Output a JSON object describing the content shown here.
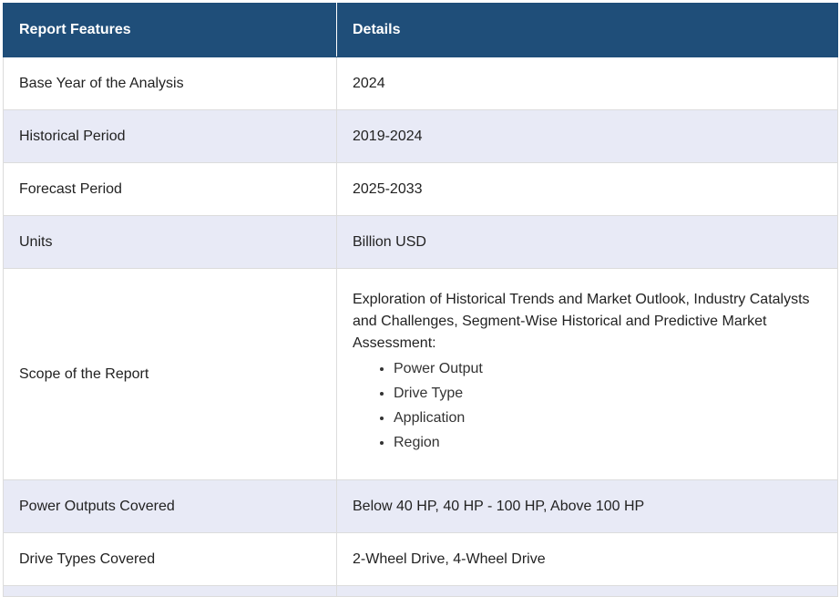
{
  "table": {
    "headers": [
      "Report Features",
      "Details"
    ],
    "rows": [
      {
        "feature": "Base Year of the Analysis",
        "detail": "2024"
      },
      {
        "feature": "Historical Period",
        "detail": "2019-2024"
      },
      {
        "feature": "Forecast Period",
        "detail": "2025-2033"
      },
      {
        "feature": "Units",
        "detail": "Billion USD"
      },
      {
        "feature": "Scope of the Report",
        "detail": "Exploration of Historical Trends and Market Outlook, Industry Catalysts and Challenges, Segment-Wise Historical and Predictive Market Assessment:",
        "list": [
          "Power Output",
          "Drive Type",
          "Application",
          "Region"
        ]
      },
      {
        "feature": "Power Outputs Covered",
        "detail": "Below 40 HP, 40 HP - 100 HP, Above 100 HP"
      },
      {
        "feature": "Drive Types Covered",
        "detail": "2-Wheel Drive, 4-Wheel Drive"
      }
    ]
  },
  "colors": {
    "header_bg": "#1f4e79",
    "header_text": "#ffffff",
    "alt_row_bg": "#e8eaf6",
    "border": "#dcdcdc"
  }
}
